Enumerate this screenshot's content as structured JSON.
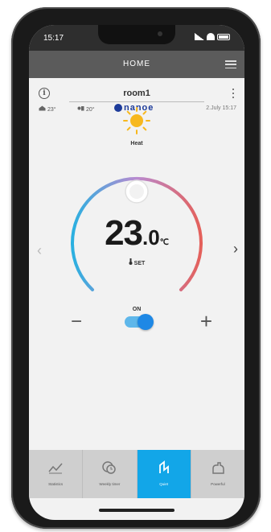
{
  "status_bar": {
    "time": "15:17"
  },
  "header": {
    "title": "HOME"
  },
  "room": {
    "name": "room1",
    "indoor_temp": "23°",
    "outdoor_temp": "20°",
    "brand": "nanoe",
    "datetime": "2.July 15:17"
  },
  "mode": {
    "label": "Heat",
    "icon": "sun-icon"
  },
  "temperature": {
    "whole": "23",
    "decimal": ".0",
    "unit": "℃",
    "set_label": "SET"
  },
  "power": {
    "label": "ON",
    "on": true
  },
  "controls": {
    "minus": "−",
    "plus": "+",
    "prev": "‹",
    "next": "›"
  },
  "bottom_nav": [
    {
      "label": "Statistics",
      "icon": "statistics-icon",
      "active": false
    },
    {
      "label": "Weekly timer",
      "icon": "weekly-timer-icon",
      "active": false
    },
    {
      "label": "Quiet",
      "icon": "quiet-icon",
      "active": true
    },
    {
      "label": "Powerful",
      "icon": "powerful-icon",
      "active": false
    }
  ],
  "colors": {
    "header": "#5b5b5b",
    "accent": "#12a6e8",
    "dial_cool": "#2ab0e0",
    "dial_warm": "#e4605a",
    "brand": "#1d3b9a"
  }
}
